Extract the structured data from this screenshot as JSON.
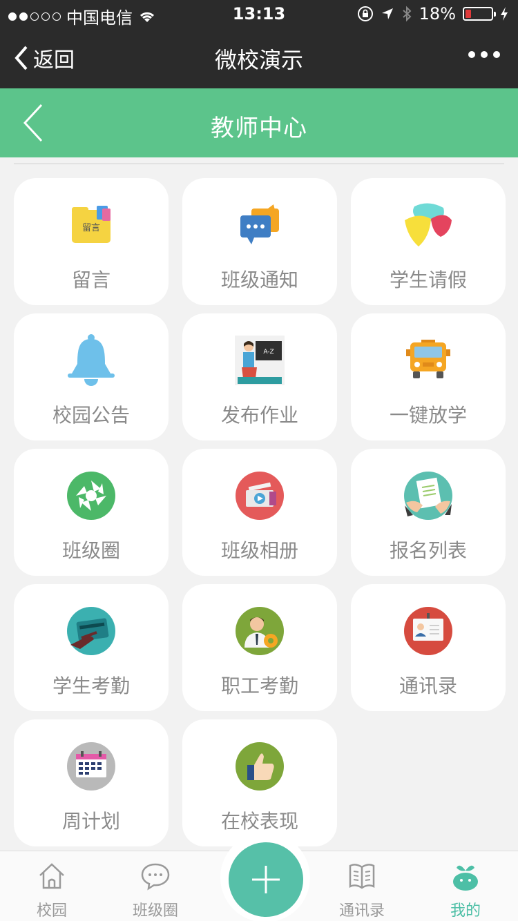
{
  "status_bar": {
    "carrier": "中国电信",
    "time": "13:13",
    "battery": "18%"
  },
  "wechat_nav": {
    "back_label": "返回",
    "title": "微校演示"
  },
  "header": {
    "title": "教师中心"
  },
  "colors": {
    "accent_green": "#5cc48b",
    "tab_active": "#4dbfa6"
  },
  "tiles": [
    {
      "label": "留言",
      "icon": "message-folder-icon"
    },
    {
      "label": "班级通知",
      "icon": "chat-notice-icon"
    },
    {
      "label": "学生请假",
      "icon": "leave-shapes-icon"
    },
    {
      "label": "校园公告",
      "icon": "bell-icon"
    },
    {
      "label": "发布作业",
      "icon": "teacher-blackboard-icon"
    },
    {
      "label": "一键放学",
      "icon": "school-bus-icon"
    },
    {
      "label": "班级圈",
      "icon": "aperture-icon"
    },
    {
      "label": "班级相册",
      "icon": "video-album-icon"
    },
    {
      "label": "报名列表",
      "icon": "signup-document-icon"
    },
    {
      "label": "学生考勤",
      "icon": "card-swipe-icon"
    },
    {
      "label": "职工考勤",
      "icon": "staff-gear-icon"
    },
    {
      "label": "通讯录",
      "icon": "contact-card-icon"
    },
    {
      "label": "周计划",
      "icon": "calendar-icon"
    },
    {
      "label": "在校表现",
      "icon": "thumbs-up-icon"
    }
  ],
  "tabbar": {
    "items": [
      {
        "label": "校园",
        "icon": "home-icon"
      },
      {
        "label": "班级圈",
        "icon": "chat-bubble-icon"
      },
      {
        "label": "通讯录",
        "icon": "book-icon"
      },
      {
        "label": "我的",
        "icon": "sprout-mascot-icon",
        "active": true
      }
    ],
    "center_button": "plus-icon"
  }
}
